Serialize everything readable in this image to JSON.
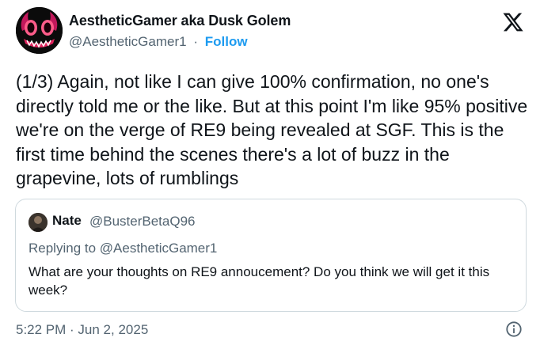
{
  "author": {
    "display_name": "AestheticGamer aka Dusk Golem",
    "handle": "@AestheticGamer1",
    "separator": "·",
    "follow_label": "Follow"
  },
  "tweet": {
    "text": "(1/3) Again, not like I can give 100% confirmation, no one's directly told me or the like. But at this point I'm like 95% positive we're on the verge of RE9 being revealed at SGF. This is the first time behind the scenes there's a lot of buzz in the grapevine, lots of rumblings",
    "timestamp": "5:22 PM · Jun 2, 2025"
  },
  "quoted_tweet": {
    "display_name": "Nate",
    "handle": "@BusterBetaQ96",
    "replying_prefix": "Replying to ",
    "replying_to": "@AestheticGamer1",
    "text": "What are your thoughts on RE9 annoucement? Do you think we will get it this week?"
  },
  "icons": {
    "brand": "x-logo-icon",
    "info": "info-icon"
  },
  "colors": {
    "text": "#0f1419",
    "secondary": "#536471",
    "link": "#1d9bf0",
    "border": "#cfd9de",
    "avatar_accent": "#e0245e"
  }
}
